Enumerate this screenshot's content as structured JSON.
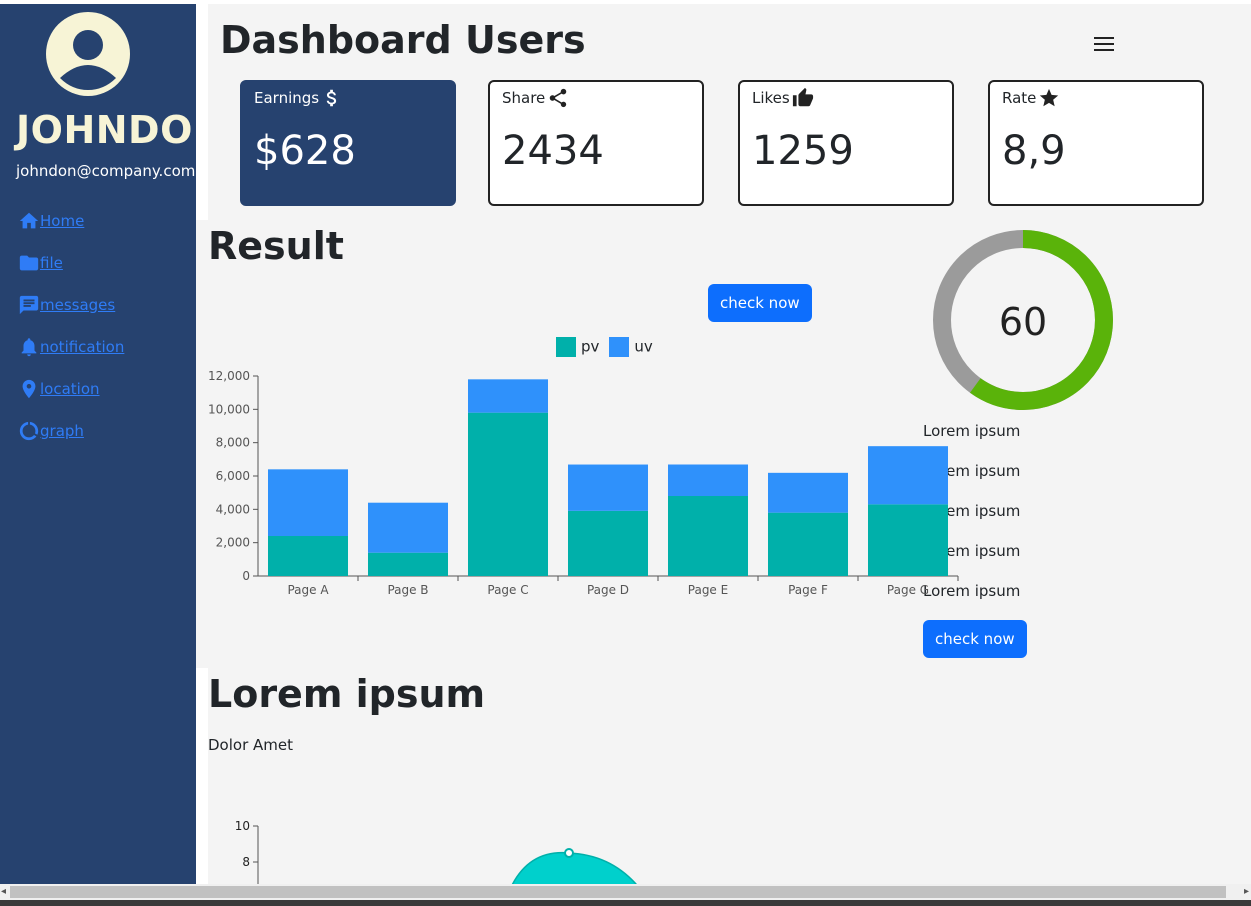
{
  "sidebar": {
    "name": "JOHNDON",
    "email": "johndon@company.com",
    "items": [
      {
        "label": " Home",
        "icon": "home-icon"
      },
      {
        "label": "file",
        "icon": "folder-icon"
      },
      {
        "label": "messages",
        "icon": "message-icon"
      },
      {
        "label": "notification",
        "icon": "bell-icon"
      },
      {
        "label": "location",
        "icon": "location-pin-icon"
      },
      {
        "label": "graph",
        "icon": "graph-icon"
      }
    ]
  },
  "header": {
    "title": "Dashboard Users",
    "menu_icon": "hamburger-icon"
  },
  "cards": [
    {
      "label": "Earnings",
      "icon": "dollar-icon",
      "value": "$628"
    },
    {
      "label": "Share",
      "icon": "share-icon",
      "value": "2434"
    },
    {
      "label": "Likes",
      "icon": "thumbs-up-icon",
      "value": "1259"
    },
    {
      "label": "Rate",
      "icon": "star-icon",
      "value": "8,9"
    }
  ],
  "result": {
    "title": "Result",
    "check_button": "check now",
    "progress_value": "60",
    "progress_percent": 60,
    "lorem_items": [
      "Lorem ipsum",
      "Lorem ipsum",
      "Lorem ipsum",
      "Lorem ipsum",
      "Lorem ipsum"
    ],
    "check_button_2": "check now"
  },
  "section2": {
    "title": "Lorem ipsum",
    "subtitle": "Dolor Amet"
  },
  "colors": {
    "sidebar": "#26426f",
    "pv": "#00b0aa",
    "uv": "#2f91fb",
    "progress": "#5ab30a",
    "progress_track": "#9b9b9b",
    "button": "#0d6efd",
    "area": "#00d0cc"
  },
  "chart_data": [
    {
      "type": "bar",
      "stacked": true,
      "categories": [
        "Page A",
        "Page B",
        "Page C",
        "Page D",
        "Page E",
        "Page F",
        "Page G"
      ],
      "series": [
        {
          "name": "pv",
          "values": [
            2400,
            1398,
            9800,
            3908,
            4800,
            3800,
            4300
          ]
        },
        {
          "name": "uv",
          "values": [
            4000,
            3000,
            2000,
            2780,
            1890,
            2390,
            3490
          ]
        }
      ],
      "yticks": [
        0,
        2000,
        4000,
        6000,
        8000,
        10000,
        12000
      ],
      "ylim": [
        0,
        12000
      ],
      "legend": "top"
    },
    {
      "type": "area",
      "yticks": [
        8,
        10
      ],
      "ylim": [
        0,
        10
      ],
      "points": [
        {
          "y": 8.5
        }
      ]
    }
  ]
}
